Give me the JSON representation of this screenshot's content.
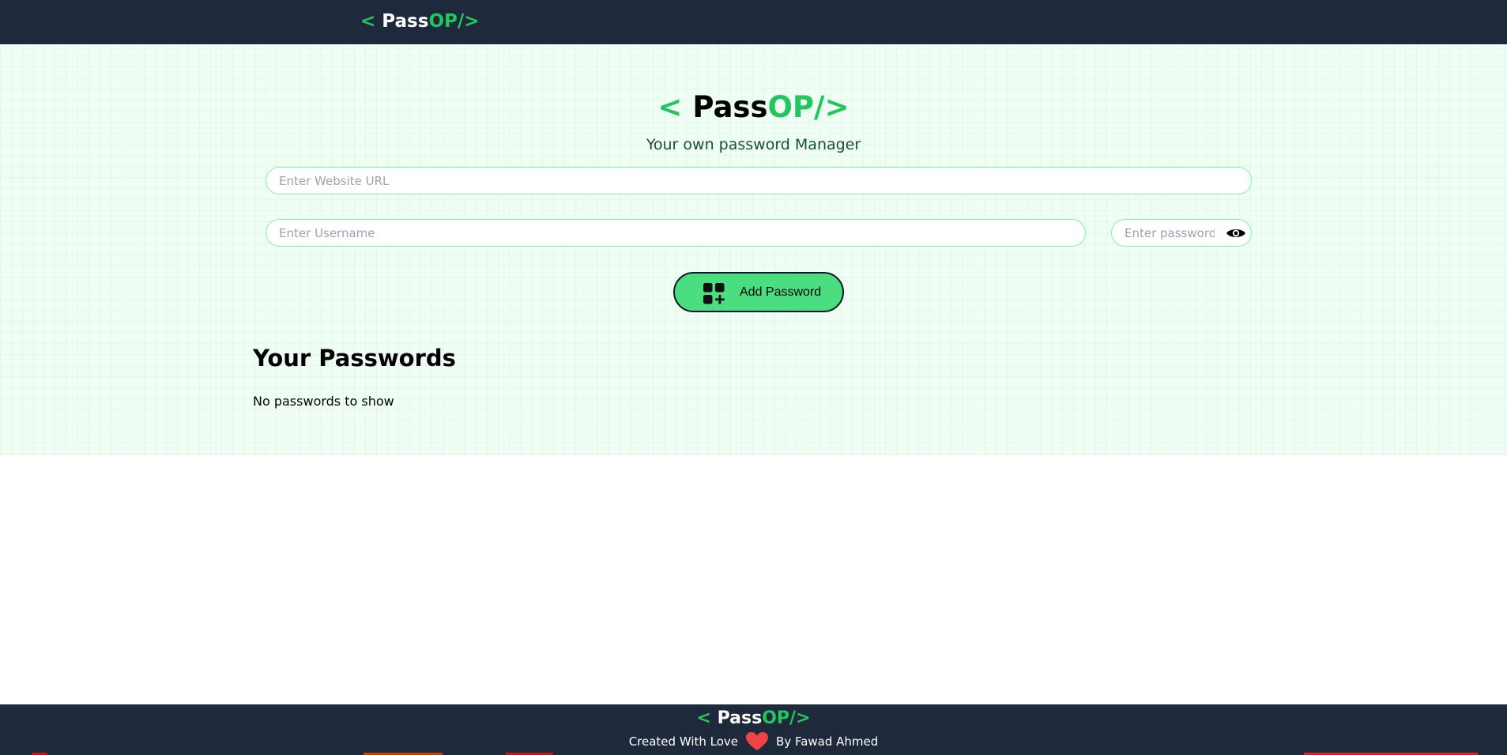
{
  "brand": {
    "open": "<",
    "pass": "Pass",
    "op": "OP/",
    "close": ">"
  },
  "hero": {
    "subtitle": "Your own password Manager"
  },
  "form": {
    "url_placeholder": "Enter Website URL",
    "username_placeholder": "Enter Username",
    "password_placeholder": "Enter password",
    "url_value": "",
    "username_value": "",
    "password_value": "",
    "add_button_label": "Add Password",
    "add_icon": "grid-add-icon",
    "toggle_icon": "eye-icon"
  },
  "passwords": {
    "title": "Your Passwords",
    "empty_text": "No passwords to show"
  },
  "footer": {
    "created_with": "Created With Love",
    "heart_icon": "heart-icon",
    "author": "By Fawad Ahmed"
  },
  "colors": {
    "navbar_bg": "#1e293b",
    "accent_green": "#22c55e",
    "button_green": "#4ade80",
    "hero_bg": "#effdf4",
    "heart": "#ef4444"
  }
}
